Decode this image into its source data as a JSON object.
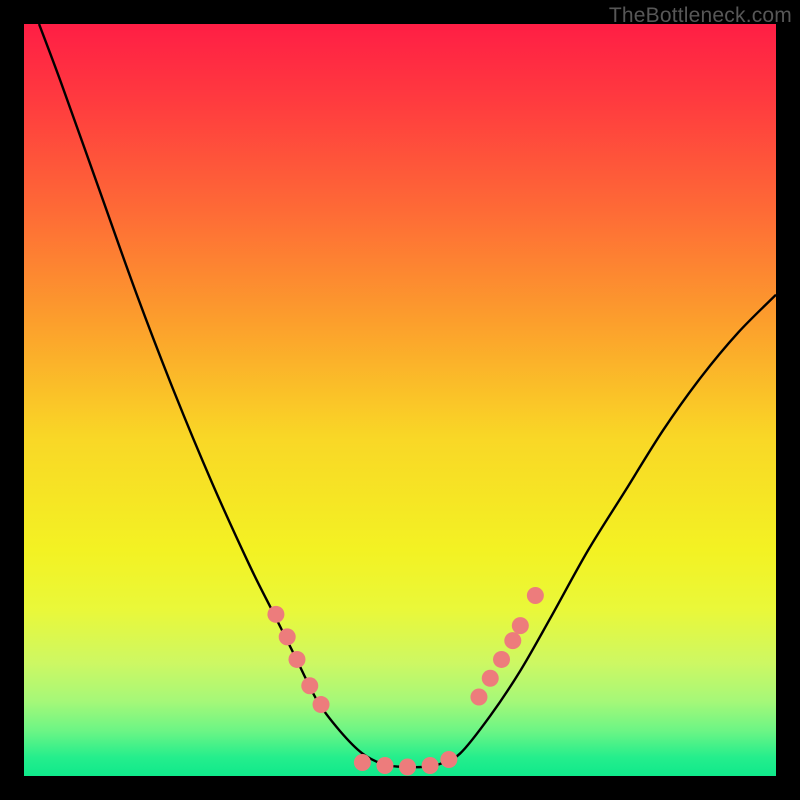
{
  "watermark": "TheBottleneck.com",
  "chart_data": {
    "type": "line",
    "title": "",
    "xlabel": "",
    "ylabel": "",
    "xlim": [
      0,
      100
    ],
    "ylim": [
      0,
      100
    ],
    "grid": false,
    "legend": false,
    "curve": {
      "name": "bottleneck-curve",
      "x": [
        2,
        5,
        10,
        15,
        20,
        25,
        30,
        33,
        36,
        39,
        42,
        45,
        48,
        51,
        53,
        55,
        58,
        62,
        66,
        70,
        75,
        80,
        85,
        90,
        95,
        100
      ],
      "y": [
        100,
        92,
        78,
        64,
        51,
        39,
        28,
        22,
        16,
        10,
        6,
        3,
        1.5,
        1.2,
        1.2,
        1.5,
        3,
        8,
        14,
        21,
        30,
        38,
        46,
        53,
        59,
        64
      ]
    },
    "markers": {
      "name": "highlight-dots",
      "color": "#ED7C7C",
      "x": [
        33.5,
        35.0,
        36.3,
        38.0,
        39.5,
        45.0,
        48.0,
        51.0,
        54.0,
        56.5,
        60.5,
        62.0,
        63.5,
        65.0,
        66.0,
        68.0
      ],
      "y": [
        21.5,
        18.5,
        15.5,
        12.0,
        9.5,
        1.8,
        1.4,
        1.2,
        1.4,
        2.2,
        10.5,
        13.0,
        15.5,
        18.0,
        20.0,
        24.0
      ]
    },
    "gradient_stops": [
      {
        "offset": 0.0,
        "color": "#FF1E45"
      },
      {
        "offset": 0.1,
        "color": "#FF3A3F"
      },
      {
        "offset": 0.25,
        "color": "#FE6B36"
      },
      {
        "offset": 0.4,
        "color": "#FCA02C"
      },
      {
        "offset": 0.55,
        "color": "#F9D726"
      },
      {
        "offset": 0.7,
        "color": "#F3F223"
      },
      {
        "offset": 0.78,
        "color": "#E9F83A"
      },
      {
        "offset": 0.85,
        "color": "#CDF863"
      },
      {
        "offset": 0.9,
        "color": "#A6F878"
      },
      {
        "offset": 0.94,
        "color": "#6CF585"
      },
      {
        "offset": 0.975,
        "color": "#25EE8C"
      },
      {
        "offset": 1.0,
        "color": "#0FE98B"
      }
    ]
  }
}
